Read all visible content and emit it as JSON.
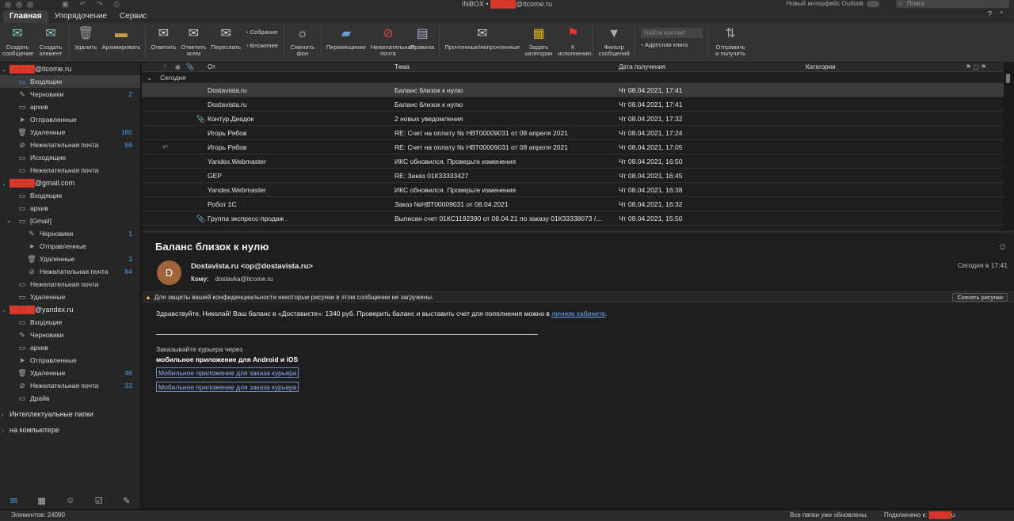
{
  "window": {
    "title_prefix": "INBOX • ",
    "title_redacted": "█████",
    "title_suffix": "@itcome.ru",
    "new_ui_label": "Новый интерфейс Outlook",
    "search_placeholder": "Поиск"
  },
  "tabs": [
    "Главная",
    "Упорядочение",
    "Сервис"
  ],
  "ribbon": {
    "new_message": "Создать сообщение",
    "new_item": "Создать элемент",
    "delete": "Удалить",
    "archive": "Архивировать",
    "reply": "Ответить",
    "reply_all": "Ответить всем",
    "forward": "Переслать",
    "meeting": "Собрание",
    "attachment": "Вложение",
    "change_bg": "Сменить фон",
    "move": "Перемещение",
    "junk": "Нежелательная почта",
    "rules": "Правила",
    "read_unread": "Прочтенные/непрочтенные",
    "categorize": "Задать категории",
    "followup": "К исполнению",
    "filter": "Фильтр сообщений",
    "find_contact": "Найти контакт",
    "address_book": "Адресная книга",
    "send_receive": "Отправить и получить"
  },
  "accounts": [
    {
      "name_redacted": "█████",
      "name_suffix": "@itcome.ru",
      "folders": [
        {
          "label": "Входящие",
          "count": "",
          "icon": "inbox-icon",
          "selected": true
        },
        {
          "label": "Черновики",
          "count": "2",
          "icon": "drafts-icon"
        },
        {
          "label": "архив",
          "count": "",
          "icon": "archive-icon"
        },
        {
          "label": "Отправленные",
          "count": "",
          "icon": "sent-icon"
        },
        {
          "label": "Удаленные",
          "count": "185",
          "icon": "trash-icon"
        },
        {
          "label": "Нежелательная почта",
          "count": "68",
          "icon": "junk-icon"
        },
        {
          "label": "Исходящие",
          "count": "",
          "icon": "outbox-icon"
        },
        {
          "label": "Нежелательная почта",
          "count": "",
          "icon": "folder-icon"
        }
      ]
    },
    {
      "name_redacted": "█████",
      "name_suffix": "@gmail.com",
      "folders": [
        {
          "label": "Входящие",
          "count": "",
          "icon": "inbox-icon"
        },
        {
          "label": "архив",
          "count": "",
          "icon": "folder-icon"
        },
        {
          "label": "[Gmail]",
          "count": "",
          "icon": "folder-icon",
          "expander": true
        },
        {
          "label": "Черновики",
          "count": "1",
          "icon": "drafts-icon",
          "sub": true
        },
        {
          "label": "Отправленные",
          "count": "",
          "icon": "sent-icon",
          "sub": true
        },
        {
          "label": "Удаленные",
          "count": "3",
          "icon": "trash-icon",
          "sub": true
        },
        {
          "label": "Нежелательная почта",
          "count": "84",
          "icon": "junk-icon",
          "sub": true
        },
        {
          "label": "Нежелательная почта",
          "count": "",
          "icon": "folder-icon"
        },
        {
          "label": "Удаленные",
          "count": "",
          "icon": "folder-icon"
        }
      ]
    },
    {
      "name_redacted": "█████",
      "name_suffix": "@yandex.ru",
      "folders": [
        {
          "label": "Входящие",
          "count": "",
          "icon": "inbox-icon"
        },
        {
          "label": "Черновики",
          "count": "",
          "icon": "drafts-icon"
        },
        {
          "label": "архив",
          "count": "",
          "icon": "archive-icon"
        },
        {
          "label": "Отправленные",
          "count": "",
          "icon": "sent-icon"
        },
        {
          "label": "Удаленные",
          "count": "46",
          "icon": "trash-icon"
        },
        {
          "label": "Нежелательная почта",
          "count": "33",
          "icon": "junk-icon"
        },
        {
          "label": "Драйв",
          "count": "",
          "icon": "folder-icon"
        }
      ]
    }
  ],
  "smart_folders": "Интеллектуальные папки",
  "on_computer": "на компьютере",
  "list_headers": {
    "from": "От",
    "subject": "Тема",
    "date": "Дата получения",
    "categories": "Категории"
  },
  "group_today": "Сегодня",
  "messages": [
    {
      "from": "Dostavista.ru",
      "subject": "Баланс близок к нулю",
      "date": "Чт 08.04.2021, 17:41",
      "selected": true,
      "icon": ""
    },
    {
      "from": "Dostavista.ru",
      "subject": "Баланс близок к нулю",
      "date": "Чт 08.04.2021, 17:41",
      "icon": ""
    },
    {
      "from": "Контур.Диадок",
      "subject": "2 новых уведомления",
      "date": "Чт 08.04.2021, 17:32",
      "icon": "",
      "attach": true
    },
    {
      "from": "Игорь Рябов",
      "subject": "RE: Счет на оплату № НВТ00009031 от 08 апреля 2021",
      "date": "Чт 08.04.2021, 17:24",
      "icon": ""
    },
    {
      "from": "Игорь Рябов",
      "subject": "RE: Счет на оплату № НВТ00009031 от 08 апреля 2021",
      "date": "Чт 08.04.2021, 17:05",
      "icon": "↶"
    },
    {
      "from": "Yandex.Webmaster",
      "subject": "ИКС обновился. Проверьте изменения",
      "date": "Чт 08.04.2021, 16:50",
      "icon": ""
    },
    {
      "from": "GEP",
      "subject": "RE: Заказ 01К33333427",
      "date": "Чт 08.04.2021, 16:45",
      "icon": ""
    },
    {
      "from": "Yandex.Webmaster",
      "subject": "ИКС обновился. Проверьте изменения",
      "date": "Чт 08.04.2021, 16:38",
      "icon": ""
    },
    {
      "from": "Робот 1С",
      "subject": "Заказ №НВТ00009031 от 08.04.2021",
      "date": "Чт 08.04.2021, 16:32",
      "icon": ""
    },
    {
      "from": "Группа экспресс-продаж .",
      "subject": "Выписан счет 01КС1192390 от 08.04.21 по заказу 01К33338073 /...",
      "date": "Чт 08.04.2021, 15:50",
      "icon": "",
      "attach": true
    }
  ],
  "reading": {
    "subject": "Баланс близок к нулю",
    "avatar_letter": "D",
    "sender": "Dostavista.ru <op@dostavista.ru>",
    "to_label": "Кому:",
    "to_value": "dostavka@itcome.ru",
    "date": "Сегодня в 17:41",
    "info": "Для защиты вашей конфиденциальности некоторые рисунки в этом сообщении не загружены.",
    "download_btn": "Скачать рисунки",
    "body_text": "Здравствуйте, Николай! Ваш баланс в «Достависте»: 1340 руб. Проверить баланс и выставить счет для пополнения можно в ",
    "body_link": "личном кабинете",
    "body_end": ".",
    "order_text": "Заказывайте курьера через",
    "app_text": "мобильное приложение для Android и iOS",
    "app_link1": "Мобильное приложение для заказа курьера",
    "app_link2": "Мобильное приложение для заказа курьера"
  },
  "status": {
    "items": "Элементов: 24090",
    "updated": "Все папки уже обновлены.",
    "connected_prefix": "Подключено к: ",
    "connected_redacted": "█████",
    "connected_suffix": "u"
  }
}
